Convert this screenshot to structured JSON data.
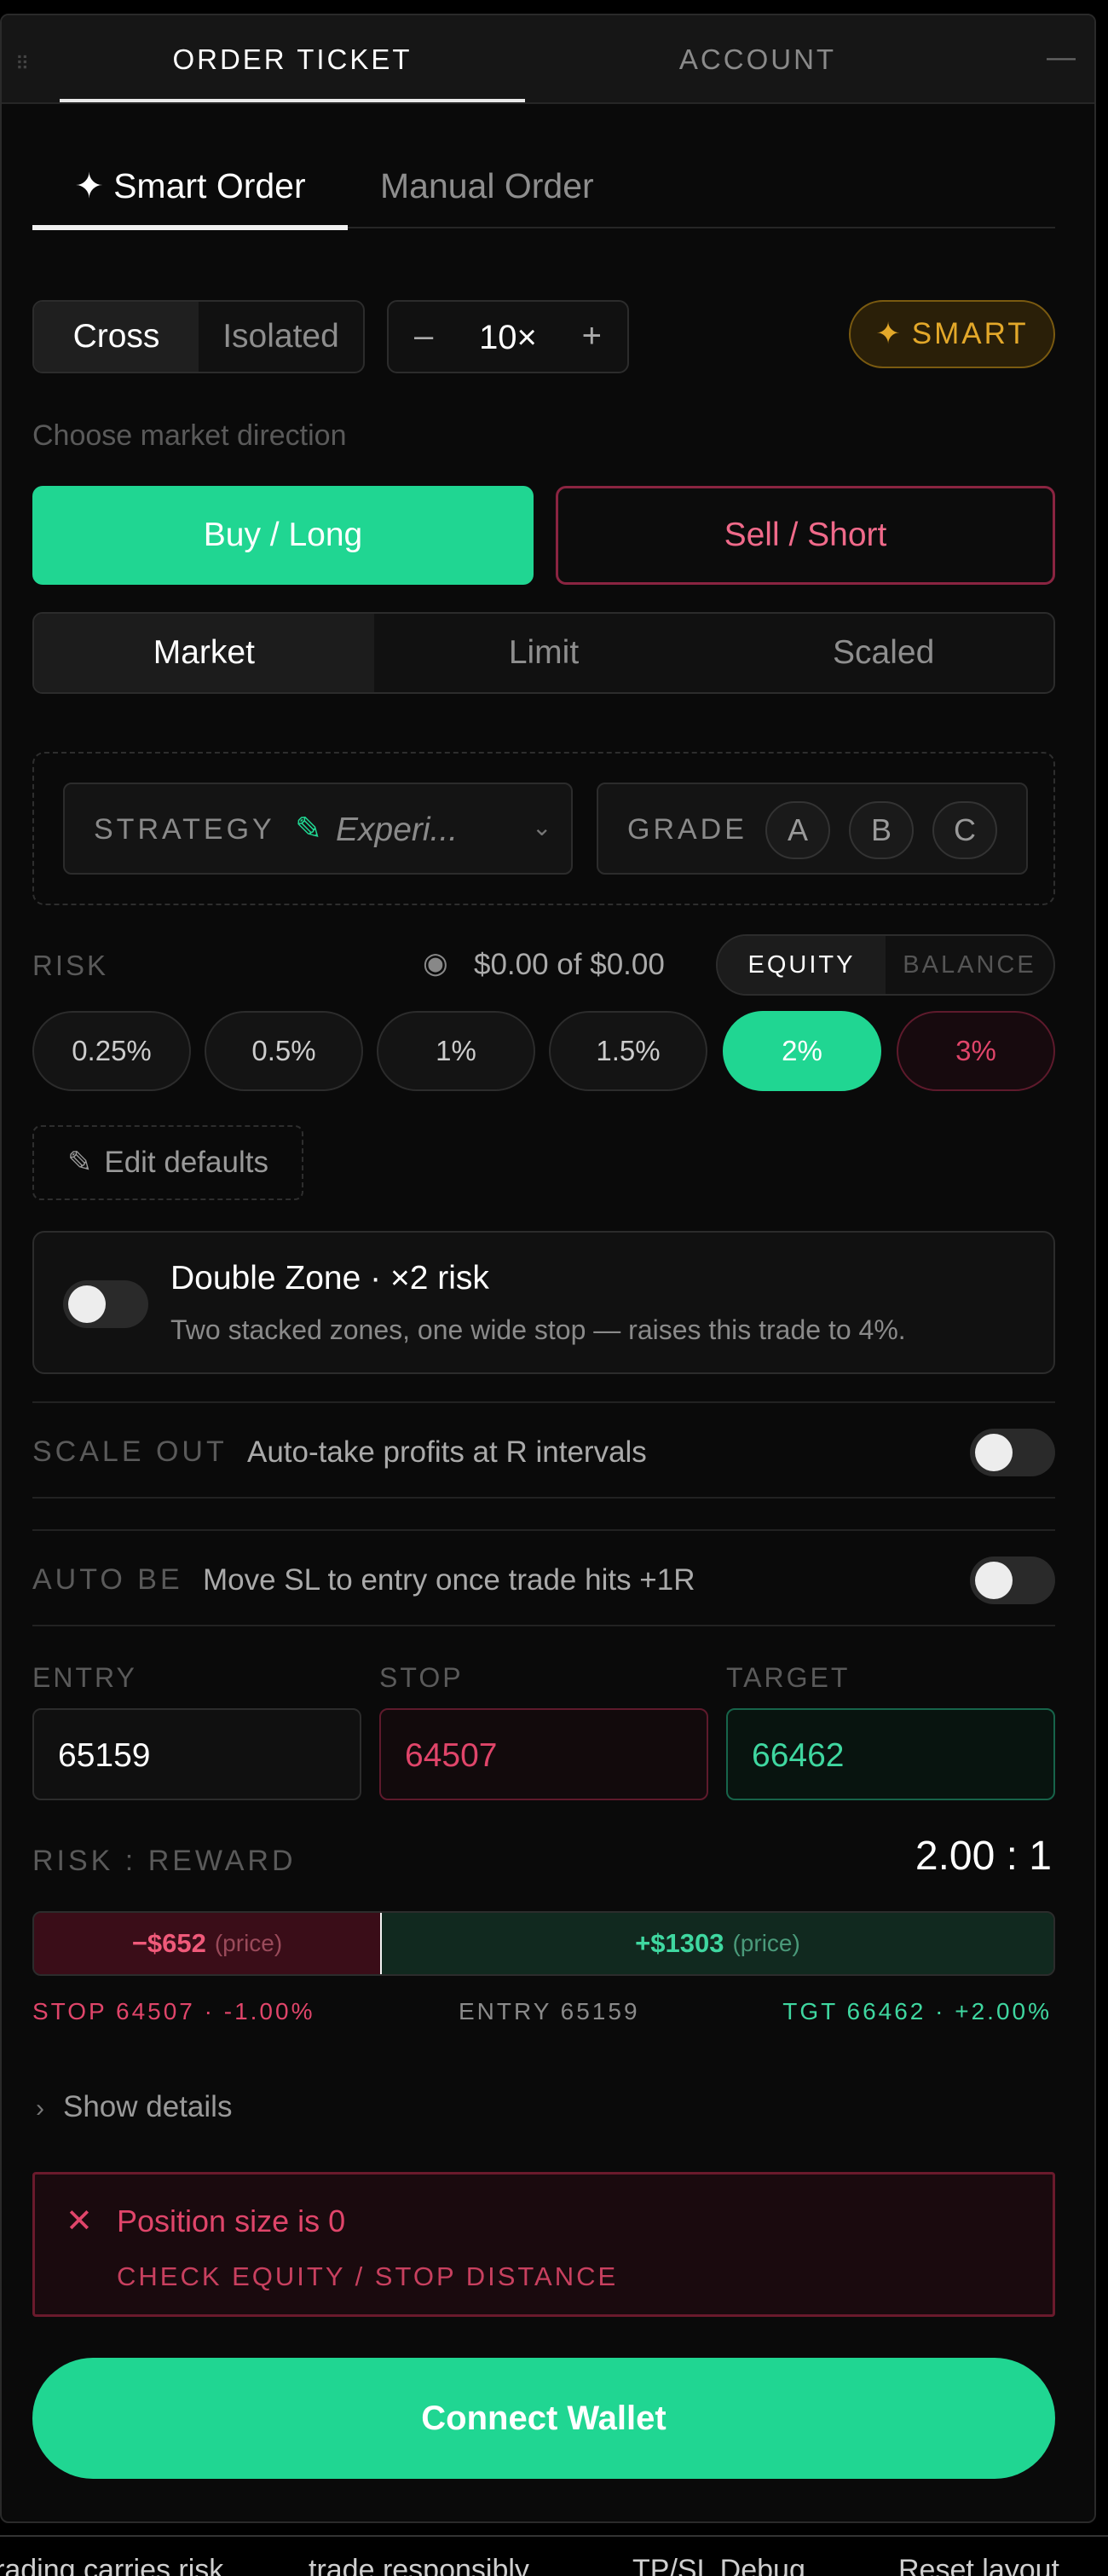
{
  "header": {
    "tabs": [
      {
        "label": "ORDER TICKET",
        "active": true
      },
      {
        "label": "ACCOUNT",
        "active": false
      }
    ],
    "collapse_icon": "minus-icon",
    "grip_icon": "drag-handle-icon"
  },
  "mode_tabs": {
    "smart": "✦ Smart Order",
    "manual": "Manual Order",
    "selected": "smart"
  },
  "margin": {
    "options": [
      "Cross",
      "Isolated"
    ],
    "selected": "Cross"
  },
  "leverage": {
    "minus": "–",
    "value": "10×",
    "plus": "+"
  },
  "smart_badge": {
    "icon": "✦",
    "label": "SMART",
    "color": "#e3a82a"
  },
  "direction": {
    "hint": "Choose market direction",
    "buy": "Buy / Long",
    "sell": "Sell / Short",
    "selected": "buy"
  },
  "order_type": {
    "options": [
      "Market",
      "Limit",
      "Scaled"
    ],
    "selected": "Market"
  },
  "strategy": {
    "label": "STRATEGY",
    "value": "Experi...",
    "icon": "pencil-icon"
  },
  "grade": {
    "label": "GRADE",
    "options": [
      "A",
      "B",
      "C"
    ]
  },
  "risk": {
    "label": "RISK",
    "amount": "$0.00 of $0.00",
    "base_options": [
      "EQUITY",
      "BALANCE"
    ],
    "base_selected": "EQUITY",
    "percents": [
      "0.25%",
      "0.5%",
      "1%",
      "1.5%",
      "2%",
      "3%"
    ],
    "selected_percent": "2%",
    "danger_percent": "3%",
    "edit_defaults": "Edit defaults"
  },
  "double_zone": {
    "title": "Double Zone · ×2 risk",
    "subtitle": "Two stacked zones, one wide stop — raises this trade to 4%.",
    "enabled": false
  },
  "scale_out": {
    "label": "SCALE OUT",
    "desc": "Auto-take profits at R intervals",
    "enabled": false
  },
  "auto_be": {
    "label": "AUTO BE",
    "desc": "Move SL to entry once trade hits +1R",
    "enabled": false
  },
  "levels": {
    "entry_label": "ENTRY",
    "entry": "65159",
    "stop_label": "STOP",
    "stop": "64507",
    "target_label": "TARGET",
    "target": "66462"
  },
  "risk_reward": {
    "label": "RISK : REWARD",
    "ratio": "2.00 : 1",
    "loss": "−$652",
    "gain": "+$1303",
    "paren": "(price)",
    "stop_legend": "STOP 64507 · -1.00%",
    "entry_legend": "ENTRY 65159",
    "target_legend": "TGT 66462 · +2.00%"
  },
  "details": {
    "label": "Show details"
  },
  "error": {
    "title": "Position size is 0",
    "hint": "CHECK EQUITY / STOP DISTANCE"
  },
  "connect": {
    "label": "Connect Wallet"
  },
  "footer": {
    "items": [
      "rading carries risk",
      "trade responsibly",
      "TP/SL Debug",
      "Reset layout"
    ]
  },
  "colors": {
    "accent": "#20d692",
    "danger": "#e0456a",
    "warning": "#e3a82a"
  }
}
